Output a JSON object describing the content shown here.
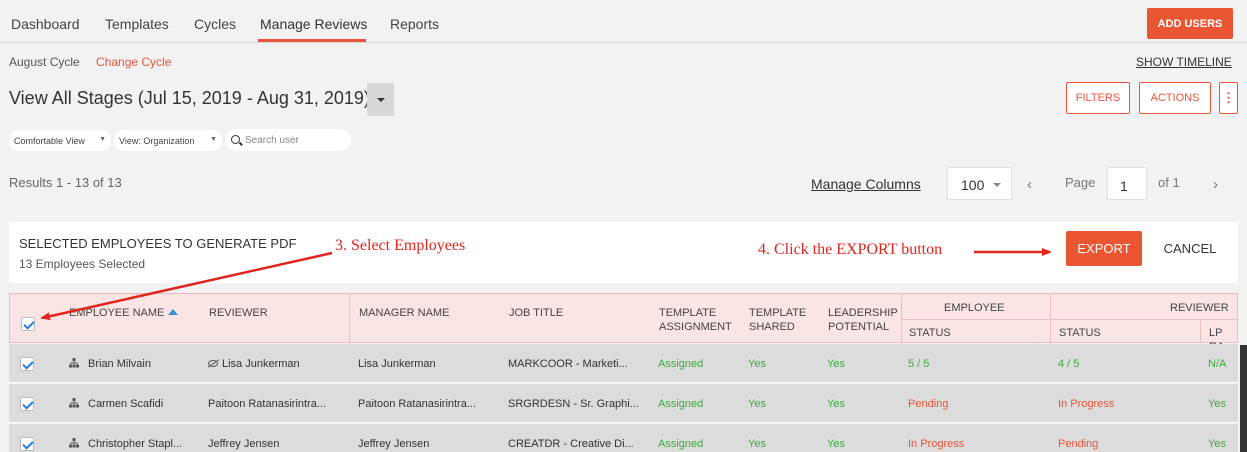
{
  "nav": {
    "items": [
      "Dashboard",
      "Templates",
      "Cycles",
      "Manage Reviews",
      "Reports"
    ],
    "active": "Manage Reviews",
    "add_users_label": "ADD USERS"
  },
  "cycle": {
    "name": "August Cycle",
    "change_label": "Change Cycle",
    "show_timeline_label": "SHOW TIMELINE"
  },
  "stage": {
    "title": "View All Stages (Jul 15, 2019 - Aug 31, 2019)"
  },
  "toolbar": {
    "filters_label": "FILTERS",
    "actions_label": "ACTIONS",
    "more_label": "⋮",
    "view_mode": "Comfortable View",
    "view_org": "View: Organization",
    "search_placeholder": "Search user"
  },
  "pagination": {
    "results_text": "Results 1 - 13 of 13",
    "manage_columns_label": "Manage Columns",
    "per_page": "100",
    "page_label": "Page",
    "page_value": "1",
    "of_label": "of 1",
    "prev_icon": "‹",
    "next_icon": "›"
  },
  "export_panel": {
    "title": "SELECTED EMPLOYEES TO GENERATE PDF",
    "subtitle": "13 Employees Selected",
    "export_label": "EXPORT",
    "cancel_label": "CANCEL"
  },
  "annotations": {
    "step3": "3. Select Employees",
    "step4": "4. Click the EXPORT button",
    "color": "#e0251f"
  },
  "table": {
    "headers": {
      "employee_name": "EMPLOYEE NAME",
      "reviewer": "REVIEWER",
      "manager_name": "MANAGER NAME",
      "job_title": "JOB TITLE",
      "template_assignment_1": "TEMPLATE",
      "template_assignment_2": "ASSIGNMENT",
      "template_shared_1": "TEMPLATE",
      "template_shared_2": "SHARED",
      "leadership_1": "LEADERSHIP",
      "leadership_2": "POTENTIAL",
      "employee_group": "EMPLOYEE",
      "employee_status": "STATUS",
      "reviewer_group": "REVIEWER",
      "reviewer_status": "STATUS",
      "lp_ra": "LP RA"
    },
    "rows": [
      {
        "employee": "Brian Milvain",
        "reviewer": "Lisa Junkerman",
        "manager": "Lisa Junkerman",
        "job": "MARKCOOR - Marketi...",
        "assignment": "Assigned",
        "shared": "Yes",
        "leadership": "Yes",
        "emp_status": "5 / 5",
        "rev_status": "4 / 5",
        "lp": "N/A"
      },
      {
        "employee": "Carmen Scafidi",
        "reviewer": "Paitoon Ratanasirintra...",
        "manager": "Paitoon Ratanasirintra...",
        "job": "SRGRDESN - Sr. Graphi...",
        "assignment": "Assigned",
        "shared": "Yes",
        "leadership": "Yes",
        "emp_status": "Pending",
        "rev_status": "In Progress",
        "lp": "Yes"
      },
      {
        "employee": "Christopher Stapl...",
        "reviewer": "Jeffrey Jensen",
        "manager": "Jeffrey Jensen",
        "job": "CREATDR - Creative Di...",
        "assignment": "Assigned",
        "shared": "Yes",
        "leadership": "Yes",
        "emp_status": "In Progress",
        "rev_status": "Pending",
        "lp": "Yes"
      }
    ]
  },
  "colors": {
    "accent": "#ea5532",
    "status_green": "#3caa3c",
    "header_pink": "#fbe4e4"
  }
}
